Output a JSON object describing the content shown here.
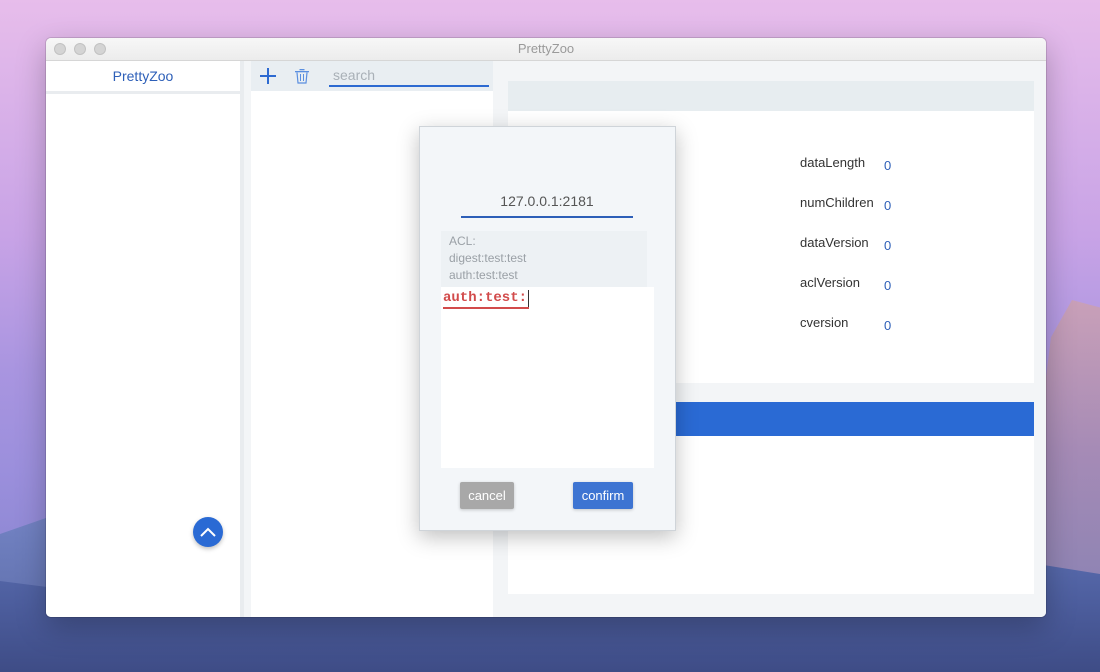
{
  "window": {
    "title": "PrettyZoo"
  },
  "sidebar": {
    "header": "PrettyZoo"
  },
  "toolbar": {
    "search_placeholder": "search"
  },
  "node_info": {
    "stats": [
      {
        "label": "dataLength",
        "value": "0"
      },
      {
        "label": "numChildren",
        "value": "0"
      },
      {
        "label": "dataVersion",
        "value": "0"
      },
      {
        "label": "aclVersion",
        "value": "0"
      },
      {
        "label": "cversion",
        "value": "0"
      }
    ]
  },
  "dialog": {
    "host": "127.0.0.1:2181",
    "acl_lines": [
      "ACL:",
      "digest:test:test",
      "auth:test:test"
    ],
    "input_value": "auth:test:",
    "cancel_label": "cancel",
    "confirm_label": "confirm"
  },
  "colors": {
    "accent": "#2a6ad4",
    "error": "#d24b4b"
  }
}
